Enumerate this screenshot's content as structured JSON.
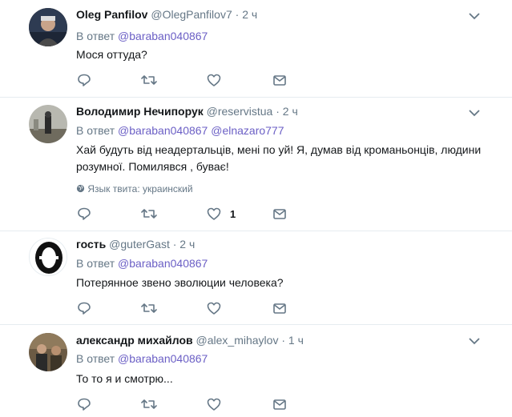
{
  "tweets": [
    {
      "name": "Oleg Panfilov",
      "handle": "@OlegPanfilov7",
      "sep": "·",
      "time": "2 ч",
      "reply_prefix": "В ответ",
      "mentions": [
        "@baraban040867"
      ],
      "text": "Мося оттуда?",
      "language": "",
      "likes": ""
    },
    {
      "name": "Володимир Нечипорук",
      "handle": "@reservistua",
      "sep": "·",
      "time": "2 ч",
      "reply_prefix": "В ответ",
      "mentions": [
        "@baraban040867",
        "@elnazaro777"
      ],
      "text": "Хай будуть від неадертальців, мені по  уй! Я, думав від кроманьонців, людини розумної. Помилявся , буває!",
      "language": "Язык твита: украинский",
      "likes": "1"
    },
    {
      "name": "гость",
      "handle": "@guterGast",
      "sep": "·",
      "time": "2 ч",
      "reply_prefix": "В ответ",
      "mentions": [
        "@baraban040867"
      ],
      "text": "Потерянное звено эволюции человека?",
      "language": "",
      "likes": ""
    },
    {
      "name": "александр михайлов",
      "handle": "@alex_mihaylov",
      "sep": "·",
      "time": "1 ч",
      "reply_prefix": "В ответ",
      "mentions": [
        "@baraban040867"
      ],
      "text": "То то я и смотрю...",
      "language": "",
      "likes": ""
    }
  ],
  "icons": {
    "reply": "reply-icon",
    "retweet": "retweet-icon",
    "like": "heart-icon",
    "dm": "envelope-icon",
    "more": "chevron-down-icon",
    "globe": "globe-icon"
  },
  "colors": {
    "mention": "#6b5fc5",
    "muted": "#657786",
    "border": "#e6ecf0",
    "text": "#14171a"
  }
}
